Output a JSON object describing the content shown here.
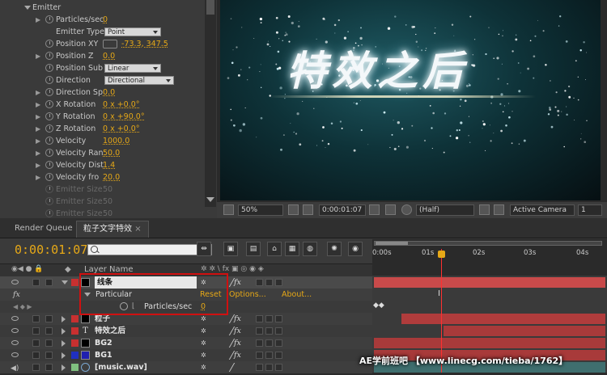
{
  "effect_controls": {
    "section_label": "Emitter",
    "rows": [
      {
        "label": "Particles/sec",
        "value": "0",
        "type": "value",
        "stopwatch": true,
        "twirl": true,
        "disabled": false
      },
      {
        "label": "Emitter Type",
        "value": "Point",
        "type": "dropdown",
        "stopwatch": false,
        "twirl": false,
        "disabled": false
      },
      {
        "label": "Position XY",
        "value": "-73.3, 347.5",
        "type": "point",
        "stopwatch": true,
        "twirl": false,
        "disabled": false
      },
      {
        "label": "Position Z",
        "value": "0.0",
        "type": "value",
        "stopwatch": true,
        "twirl": true,
        "disabled": false
      },
      {
        "label": "Position Sub",
        "value": "Linear",
        "type": "dropdown",
        "stopwatch": true,
        "twirl": false,
        "disabled": false
      },
      {
        "label": "Direction",
        "value": "Directional",
        "type": "dropdown",
        "stopwatch": true,
        "twirl": false,
        "disabled": false
      },
      {
        "label": "Direction Sp",
        "value": "0.0",
        "type": "value",
        "stopwatch": true,
        "twirl": true,
        "disabled": false
      },
      {
        "label": "X Rotation",
        "value": "0 x +0.0°",
        "type": "value",
        "stopwatch": true,
        "twirl": true,
        "disabled": false
      },
      {
        "label": "Y Rotation",
        "value": "0 x +90.0°",
        "type": "value",
        "stopwatch": true,
        "twirl": true,
        "disabled": false
      },
      {
        "label": "Z Rotation",
        "value": "0 x +0.0°",
        "type": "value",
        "stopwatch": true,
        "twirl": true,
        "disabled": false
      },
      {
        "label": "Velocity",
        "value": "1000.0",
        "type": "value",
        "stopwatch": true,
        "twirl": true,
        "disabled": false
      },
      {
        "label": "Velocity Ran",
        "value": "50.0",
        "type": "value",
        "stopwatch": true,
        "twirl": true,
        "disabled": false
      },
      {
        "label": "Velocity Dist",
        "value": "1.4",
        "type": "value",
        "stopwatch": true,
        "twirl": true,
        "disabled": false
      },
      {
        "label": "Velocity fro",
        "value": "20.0",
        "type": "value",
        "stopwatch": true,
        "twirl": true,
        "disabled": false
      },
      {
        "label": "Emitter Size",
        "value": "50",
        "type": "value",
        "stopwatch": true,
        "twirl": false,
        "disabled": true
      },
      {
        "label": "Emitter Size",
        "value": "50",
        "type": "value",
        "stopwatch": true,
        "twirl": false,
        "disabled": true
      },
      {
        "label": "Emitter Size",
        "value": "50",
        "type": "value",
        "stopwatch": true,
        "twirl": false,
        "disabled": true
      }
    ]
  },
  "viewer": {
    "canvas_text": "特效之后",
    "zoom": "50%",
    "timecode": "0:00:01:07",
    "resolution": "(Half)",
    "camera": "Active Camera",
    "view_count": "1"
  },
  "timeline": {
    "tabs": [
      "Render Queue",
      "粒子文字特效"
    ],
    "current_time": "0:00:01:07",
    "column_layer_name": "Layer Name",
    "ruler_ticks": [
      "0:00s",
      "01s",
      "02s",
      "03s",
      "04s"
    ],
    "layers": [
      {
        "name": "线条",
        "label_color": "#c83030",
        "source": "solid-black",
        "expanded": true,
        "selected": true,
        "bar_color": "#c84a4a",
        "bar_start": 0.0
      },
      {
        "name": "粒子",
        "label_color": "#c83030",
        "source": "solid-black",
        "expanded": false,
        "selected": false,
        "bar_color": "#b03c3c",
        "bar_start": 0.12
      },
      {
        "name": "特效之后",
        "label_color": "#c83030",
        "source": "text",
        "expanded": false,
        "selected": false,
        "bar_color": "#a83a3a",
        "bar_start": 0.3
      },
      {
        "name": "BG2",
        "label_color": "#c83030",
        "source": "solid-black",
        "expanded": false,
        "selected": false,
        "bar_color": "#a83a3a",
        "bar_start": 0.0
      },
      {
        "name": "BG1",
        "label_color": "#2030c0",
        "source": "solid-blue",
        "expanded": false,
        "selected": false,
        "bar_color": "#a83a3a",
        "bar_start": 0.0
      },
      {
        "name": "[music.wav]",
        "label_color": "#7fbf7f",
        "source": "audio",
        "expanded": false,
        "selected": false,
        "bar_color": "#3f6f6f",
        "bar_start": 0.0
      }
    ],
    "effect_row": {
      "name": "Particular",
      "reset": "Reset",
      "options": "Options...",
      "about": "About..."
    },
    "property_row": {
      "name": "Particles/sec",
      "value": "0"
    },
    "fx_glyph": "fx"
  },
  "watermark": "AE学前班吧 【www.linecg.com/tieba/1762】",
  "colors": {
    "accent": "#e6a817",
    "playhead": "#ff3030",
    "highlight_box": "#d01010"
  }
}
